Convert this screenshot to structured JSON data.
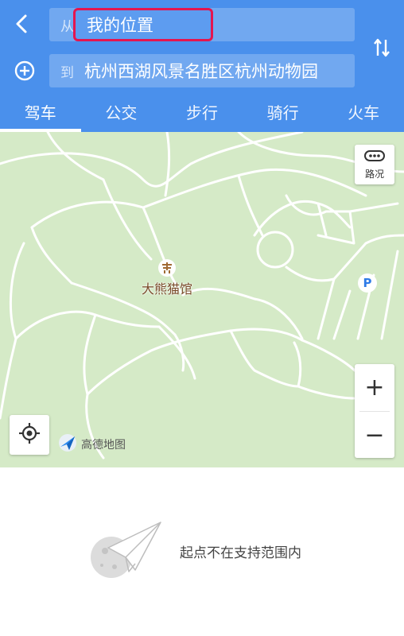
{
  "header": {
    "from_prefix": "从",
    "from_value": "我的位置",
    "to_prefix": "到",
    "to_value": "杭州西湖风景名胜区杭州动物园",
    "back_icon": "chevron-left-icon",
    "add_icon": "plus-circle-icon",
    "swap_icon": "swap-vertical-icon"
  },
  "tabs": [
    {
      "label": "驾车",
      "active": true
    },
    {
      "label": "公交",
      "active": false
    },
    {
      "label": "步行",
      "active": false
    },
    {
      "label": "骑行",
      "active": false
    },
    {
      "label": "火车",
      "active": false
    }
  ],
  "map": {
    "traffic_label": "路况",
    "poi_label": "大熊猫馆",
    "parking_label": "P",
    "zoom_in": "+",
    "zoom_out": "−",
    "brand_label": "高德地图"
  },
  "bottom": {
    "message": "起点不在支持范围内"
  },
  "colors": {
    "header_bg": "#4a90ec",
    "map_bg": "#d5eac7",
    "highlight_border": "#e4154f"
  }
}
